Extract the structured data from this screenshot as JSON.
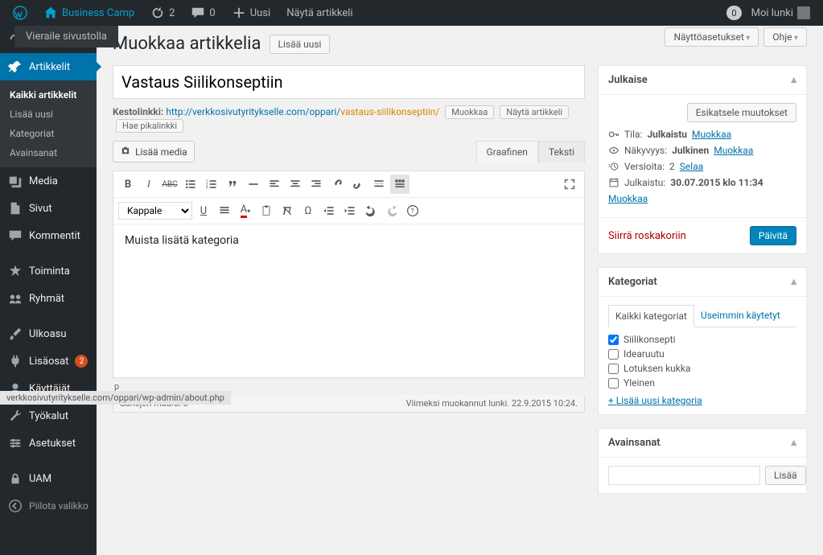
{
  "adminbar": {
    "site_name": "Business Camp",
    "pending_count": "2",
    "comment_count": "0",
    "new_label": "Uusi",
    "view_label": "Näytä artikkeli",
    "greeting": "Moi lunki",
    "zero_count": "0",
    "flyout": "Vieraile sivustolla"
  },
  "sidebar": {
    "dashboard": "",
    "posts": "Artikkelit",
    "posts_sub": [
      "Kaikki artikkelit",
      "Lisää uusi",
      "Kategoriat",
      "Avainsanat"
    ],
    "media": "Media",
    "pages": "Sivut",
    "comments": "Kommentit",
    "activity": "Toiminta",
    "groups": "Ryhmät",
    "appearance": "Ulkoasu",
    "plugins": "Lisäosat",
    "plugins_updates": "2",
    "users": "Käyttäjät",
    "tools": "Työkalut",
    "settings": "Asetukset",
    "uam": "UAM",
    "collapse": "Piilota valikko"
  },
  "header": {
    "title": "Muokkaa artikkelia",
    "add_new": "Lisää uusi",
    "screen_options": "Näyttöasetukset",
    "help": "Ohje"
  },
  "post": {
    "title": "Vastaus Siilikonseptiin",
    "permalink_label": "Kestolinkki:",
    "permalink_base": "http://verkkosivutyritykselle.com/oppari/",
    "permalink_slug": "vastaus-siilikonseptiin/",
    "permalink_buttons": [
      "Muokkaa",
      "Näytä artikkeli",
      "Hae pikalinkki"
    ],
    "add_media": "Lisää media",
    "tabs": {
      "visual": "Graafinen",
      "text": "Teksti"
    },
    "format_select": "Kappale",
    "content": "Muista lisätä kategoria",
    "path": "p",
    "word_count": "Sanojen määrä: 3",
    "last_edit": "Viimeksi muokannut lunki. 22.9.2015 10:24."
  },
  "publish": {
    "heading": "Julkaise",
    "preview": "Esikatsele muutokset",
    "status_label": "Tila:",
    "status_value": "Julkaistu",
    "edit": "Muokkaa",
    "visibility_label": "Näkyvyys:",
    "visibility_value": "Julkinen",
    "revisions_label": "Versioita:",
    "revisions_value": "2",
    "browse": "Selaa",
    "published_label": "Julkaistu:",
    "published_value": "30.07.2015 klo 11:34",
    "trash": "Siirrä roskakoriin",
    "submit": "Päivitä"
  },
  "categories": {
    "heading": "Kategoriat",
    "tab_all": "Kaikki kategoriat",
    "tab_used": "Useimmin käytetyt",
    "items": [
      {
        "label": "Siilikonsepti",
        "checked": true
      },
      {
        "label": "Idearuutu",
        "checked": false
      },
      {
        "label": "Lotuksen kukka",
        "checked": false
      },
      {
        "label": "Yleinen",
        "checked": false
      }
    ],
    "add_new": "+ Lisää uusi kategoria"
  },
  "tags": {
    "heading": "Avainsanat",
    "add": "Lisää"
  },
  "footerbar": "verkkosivutyritykselle.com/oppari/wp-admin/about.php"
}
